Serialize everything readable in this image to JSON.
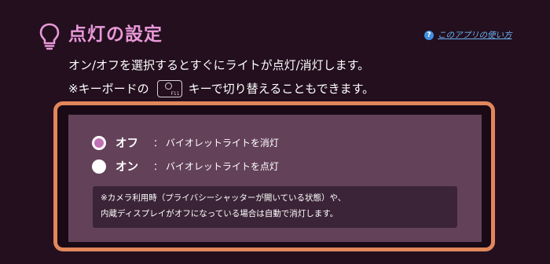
{
  "header": {
    "icon": "lightbulb-icon",
    "title": "点灯の設定",
    "help_icon": "question-circle-icon",
    "help_link": "このアプリの使い方"
  },
  "description": {
    "line1": "オン/オフを選択するとすぐにライトが点灯/消灯します。",
    "line2_prefix": "※キーボードの",
    "key_icon": "keyboard-f11-key-icon",
    "key_label": "F11",
    "line2_suffix": "キーで切り替えることもできます。"
  },
  "options": [
    {
      "label": "オフ",
      "description": "：  バイオレットライトを消灯",
      "selected": true
    },
    {
      "label": "オン",
      "description": "：  バイオレットライトを点灯",
      "selected": false
    }
  ],
  "note": {
    "line1": "※カメラ利用時（プライバシーシャッターが開いている状態）や、",
    "line2": "内蔵ディスプレイがオフになっている場合は自動で消灯します。"
  },
  "colors": {
    "background": "#230f1e",
    "title": "#e898d8",
    "panel": "#634159",
    "frame_border": "#e2875b",
    "link": "#6ab0f0",
    "radio_selected": "#c070b4"
  }
}
